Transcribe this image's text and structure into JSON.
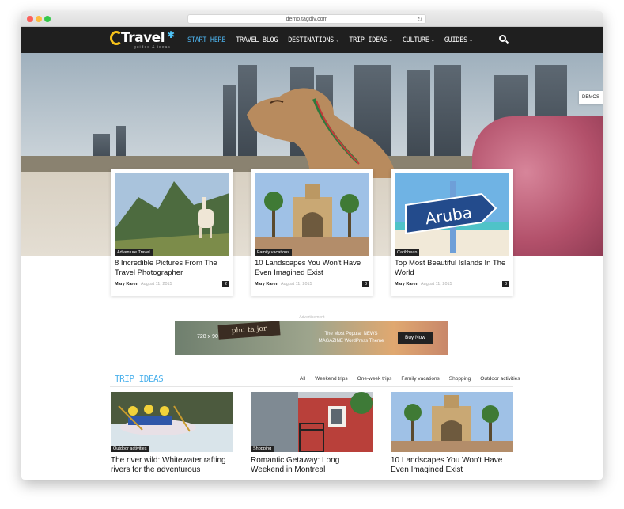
{
  "browser": {
    "url": "demo.tagdiv.com"
  },
  "brand": {
    "logo_text": "Travel",
    "logo_sub": "guides & ideas"
  },
  "nav": {
    "items": [
      {
        "label": "START HERE",
        "active": true,
        "dropdown": false
      },
      {
        "label": "TRAVEL BLOG",
        "active": false,
        "dropdown": false
      },
      {
        "label": "DESTINATIONS",
        "active": false,
        "dropdown": true
      },
      {
        "label": "TRIP IDEAS",
        "active": false,
        "dropdown": true
      },
      {
        "label": "CULTURE",
        "active": false,
        "dropdown": true
      },
      {
        "label": "GUIDES",
        "active": false,
        "dropdown": true
      }
    ]
  },
  "demos_label": "DEMOS",
  "featured": [
    {
      "category": "Adventure Travel",
      "title": "8 Incredible Pictures From The Travel Photographer",
      "author": "Mary Karen",
      "date": "August 11, 2015",
      "comments": "2"
    },
    {
      "category": "Family vacations",
      "title": "10 Landscapes You Won't Have Even Imagined Exist",
      "author": "Mary Karen",
      "date": "August 11, 2015",
      "comments": "0"
    },
    {
      "category": "Caribbean",
      "title": "Top Most Beautiful Islands In The World",
      "author": "Mary Karen",
      "date": "August 11, 2015",
      "comments": "0"
    }
  ],
  "ad": {
    "label": "- Advertisement -",
    "size": "728 x 90 Ad",
    "sign": "phu ta jor",
    "text": "The Most Popular NEWS MAGAZINE WordPress Theme",
    "button": "Buy Now"
  },
  "trip_ideas": {
    "heading": "TRIP IDEAS",
    "filters": [
      "All",
      "Weekend trips",
      "One-week trips",
      "Family vacations",
      "Shopping",
      "Outdoor activities"
    ],
    "posts": [
      {
        "category": "Outdoor activities",
        "title": "The river wild: Whitewater rafting rivers for the adventurous"
      },
      {
        "category": "Shopping",
        "title": "Romantic Getaway: Long Weekend in Montreal"
      },
      {
        "category": "",
        "title": "10 Landscapes You Won't Have Even Imagined Exist"
      }
    ]
  },
  "colors": {
    "accent": "#4db2ec",
    "nav_bg": "#1f1f1f",
    "logo_yellow": "#f6c21b"
  }
}
